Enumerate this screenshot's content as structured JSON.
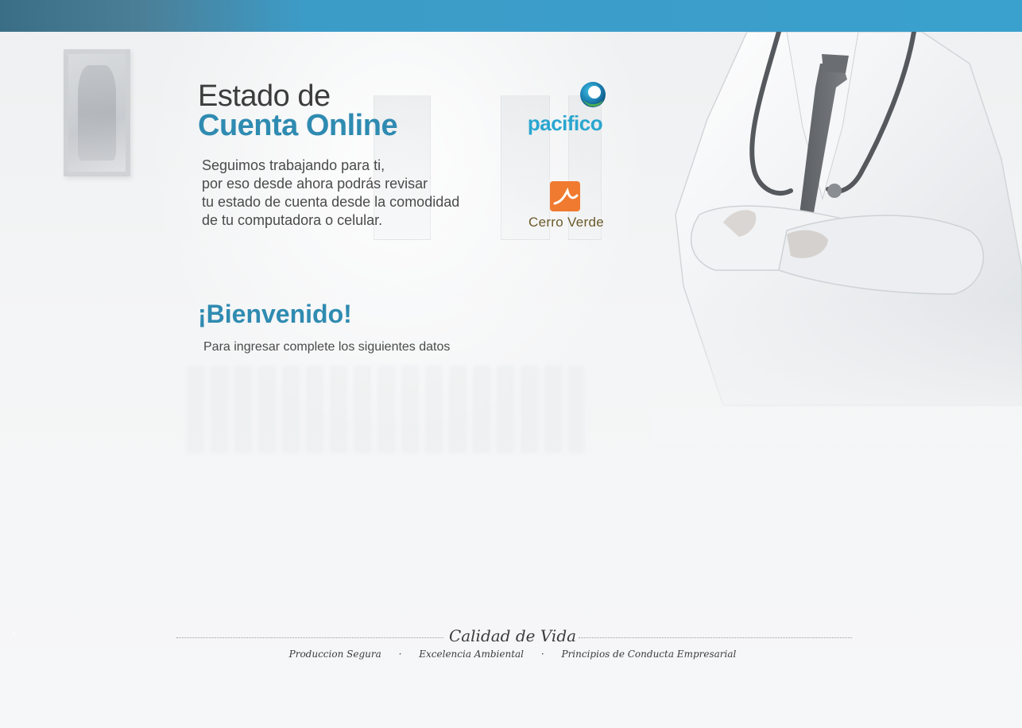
{
  "header": {
    "title_line1": "Estado de",
    "title_line2": "Cuenta Online"
  },
  "intro": {
    "lines": [
      "Seguimos trabajando para ti,",
      "por eso desde ahora podrás revisar",
      "tu estado de cuenta desde la comodidad",
      "de tu computadora o celular."
    ]
  },
  "logos": {
    "pacifico": {
      "text": "pacifico",
      "color": "#2aa6cf",
      "icon": "pacifico-circle-icon"
    },
    "cerro_verde": {
      "text": "Cerro Verde",
      "color": "#f07a2f",
      "icon": "cerro-verde-square-icon"
    }
  },
  "welcome": {
    "heading": "¡Bienvenido!",
    "instructions": "Para ingresar complete los siguientes datos"
  },
  "footer": {
    "title": "Calidad de Vida",
    "links": [
      "Produccion Segura",
      "Excelencia Ambiental",
      "Principios de Conducta Empresarial"
    ],
    "separator": "·"
  },
  "colors": {
    "topbar": "#3aa0cd",
    "accent": "#2f8bb1"
  }
}
